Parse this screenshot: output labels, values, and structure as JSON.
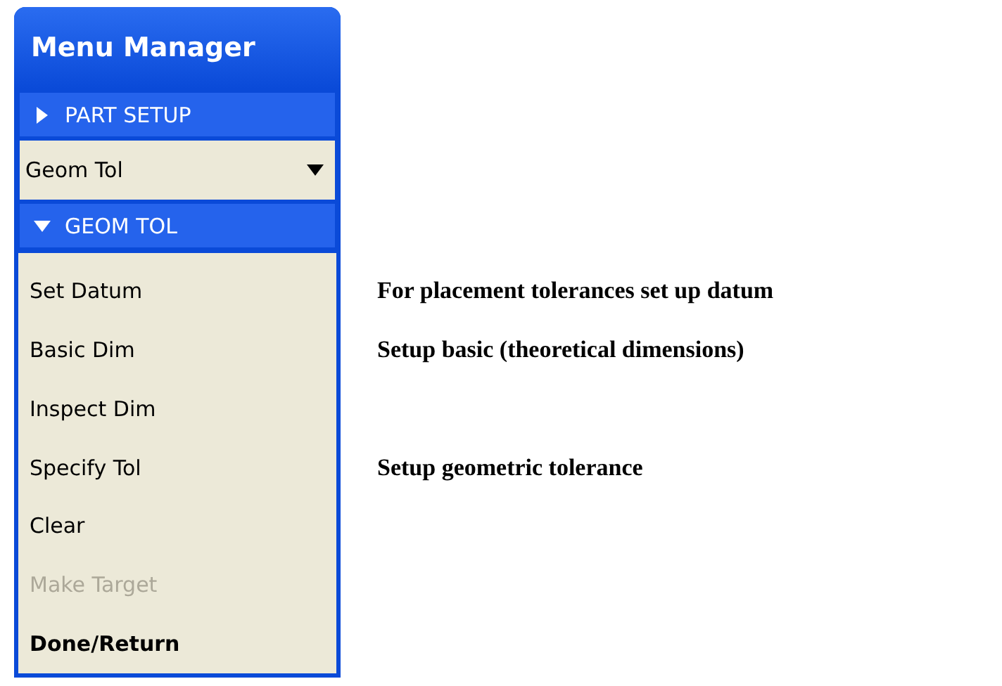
{
  "menu_manager": {
    "title": "Menu Manager",
    "sections": [
      {
        "label": "PART SETUP",
        "expanded": false
      }
    ],
    "dropdown": {
      "value": "Geom Tol"
    },
    "active_section": {
      "label": "GEOM TOL",
      "expanded": true
    },
    "items": [
      {
        "label": "Set Datum",
        "kind": "command",
        "disabled": false,
        "note": "For placement tolerances set up datum"
      },
      {
        "label": "Basic Dim",
        "kind": "command",
        "disabled": false,
        "note": "Setup basic (theoretical dimensions)"
      },
      {
        "label": "Inspect Dim",
        "kind": "command",
        "disabled": false
      },
      {
        "label": "Specify Tol",
        "kind": "command",
        "disabled": false,
        "note": "Setup geometric tolerance"
      },
      {
        "label": "Clear",
        "kind": "command",
        "disabled": false
      },
      {
        "label": "Make Target",
        "kind": "command",
        "disabled": true
      },
      {
        "label": "Done/Return",
        "kind": "exit",
        "disabled": false
      }
    ]
  }
}
